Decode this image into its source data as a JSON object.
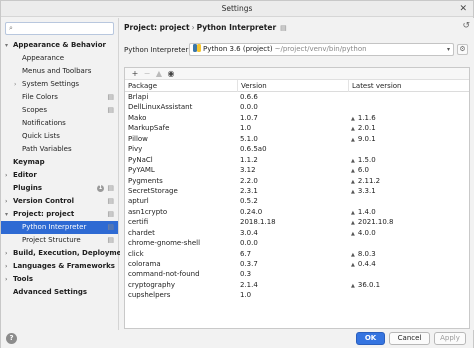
{
  "window": {
    "title": "Settings"
  },
  "sidebar": {
    "search_placeholder": "",
    "items": [
      {
        "label": "Appearance & Behavior",
        "level": 0,
        "arrow": "▾",
        "bold": true
      },
      {
        "label": "Appearance",
        "level": 1
      },
      {
        "label": "Menus and Toolbars",
        "level": 1
      },
      {
        "label": "System Settings",
        "level": 1,
        "arrow": "›"
      },
      {
        "label": "File Colors",
        "level": 1,
        "gear": true
      },
      {
        "label": "Scopes",
        "level": 1,
        "gear": true
      },
      {
        "label": "Notifications",
        "level": 1
      },
      {
        "label": "Quick Lists",
        "level": 1
      },
      {
        "label": "Path Variables",
        "level": 1
      },
      {
        "label": "Keymap",
        "level": 0,
        "bold": true
      },
      {
        "label": "Editor",
        "level": 0,
        "arrow": "›",
        "bold": true
      },
      {
        "label": "Plugins",
        "level": 0,
        "bold": true,
        "badge": "1",
        "gear": true
      },
      {
        "label": "Version Control",
        "level": 0,
        "arrow": "›",
        "bold": true,
        "gear": true
      },
      {
        "label": "Project: project",
        "level": 0,
        "arrow": "▾",
        "bold": true,
        "gear": true
      },
      {
        "label": "Python Interpreter",
        "level": 1,
        "selected": true,
        "gear": true
      },
      {
        "label": "Project Structure",
        "level": 1,
        "gear": true
      },
      {
        "label": "Build, Execution, Deployment",
        "level": 0,
        "arrow": "›",
        "bold": true
      },
      {
        "label": "Languages & Frameworks",
        "level": 0,
        "arrow": "›",
        "bold": true
      },
      {
        "label": "Tools",
        "level": 0,
        "arrow": "›",
        "bold": true
      },
      {
        "label": "Advanced Settings",
        "level": 0,
        "bold": true
      }
    ]
  },
  "breadcrumb": {
    "project": "Project: project",
    "separator": "›",
    "page": "Python Interpreter"
  },
  "interpreter": {
    "label": "Python Interpreter:",
    "value": "Python 3.6 (project)",
    "path": "~/project/venv/bin/python"
  },
  "toolbar": {
    "add": "+",
    "remove": "−",
    "upgrade": "▲",
    "show": "◉"
  },
  "table": {
    "headers": [
      "Package",
      "Version",
      "Latest version"
    ],
    "rows": [
      [
        "Brlapi",
        "0.6.6",
        ""
      ],
      [
        "DellLinuxAssistant",
        "0.0.0",
        ""
      ],
      [
        "Mako",
        "1.0.7",
        "1.1.6"
      ],
      [
        "MarkupSafe",
        "1.0",
        "2.0.1"
      ],
      [
        "Pillow",
        "5.1.0",
        "9.0.1"
      ],
      [
        "Pivy",
        "0.6.5a0",
        ""
      ],
      [
        "PyNaCl",
        "1.1.2",
        "1.5.0"
      ],
      [
        "PyYAML",
        "3.12",
        "6.0"
      ],
      [
        "Pygments",
        "2.2.0",
        "2.11.2"
      ],
      [
        "SecretStorage",
        "2.3.1",
        "3.3.1"
      ],
      [
        "apturl",
        "0.5.2",
        ""
      ],
      [
        "asn1crypto",
        "0.24.0",
        "1.4.0"
      ],
      [
        "certifi",
        "2018.1.18",
        "2021.10.8"
      ],
      [
        "chardet",
        "3.0.4",
        "4.0.0"
      ],
      [
        "chrome-gnome-shell",
        "0.0.0",
        ""
      ],
      [
        "click",
        "6.7",
        "8.0.3"
      ],
      [
        "colorama",
        "0.3.7",
        "0.4.4"
      ],
      [
        "command-not-found",
        "0.3",
        ""
      ],
      [
        "cryptography",
        "2.1.4",
        "36.0.1"
      ],
      [
        "cupshelpers",
        "1.0",
        ""
      ]
    ]
  },
  "footer": {
    "help": "?",
    "ok": "OK",
    "cancel": "Cancel",
    "apply": "Apply"
  },
  "colors": {
    "accent": "#2e6ad3",
    "ok_button": "#3574e0"
  }
}
